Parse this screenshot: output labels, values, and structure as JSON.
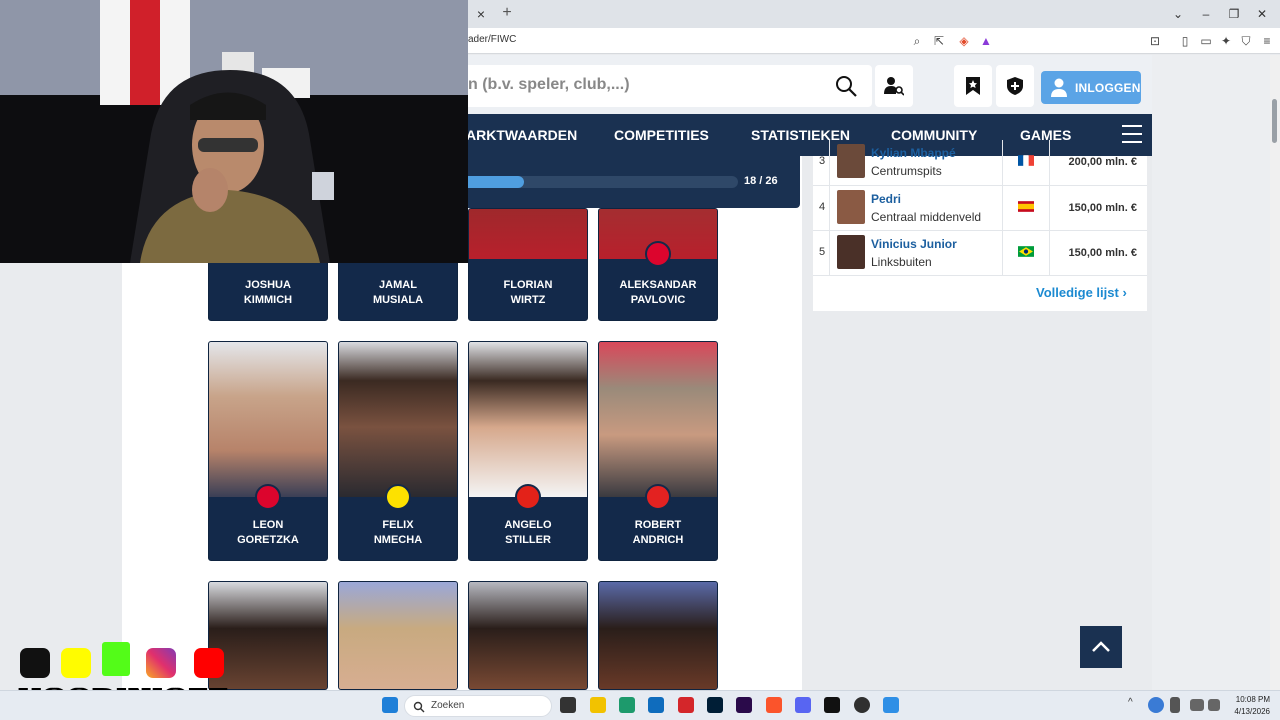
{
  "browser": {
    "url": "ader/FIWC",
    "tab_close": "×",
    "tab_new": "+"
  },
  "header": {
    "search_placeholder": "n (b.v. speler, club,...)",
    "login_label": "INLOGGEN"
  },
  "nav": {
    "items": [
      "ARKTWAARDEN",
      "COMPETITIES",
      "STATISTIEKEN",
      "COMMUNITY",
      "GAMES"
    ]
  },
  "progress": {
    "text": "18 / 26",
    "current": 18,
    "total": 26
  },
  "players_row1": [
    {
      "first": "JOSHUA",
      "last": "KIMMICH"
    },
    {
      "first": "JAMAL",
      "last": "MUSIALA"
    },
    {
      "first": "FLORIAN",
      "last": "WIRTZ"
    },
    {
      "first": "ALEKSANDAR",
      "last": "PAVLOVIC"
    }
  ],
  "players_row2": [
    {
      "first": "LEON",
      "last": "GORETZKA"
    },
    {
      "first": "FELIX",
      "last": "NMECHA"
    },
    {
      "first": "ANGELO",
      "last": "STILLER"
    },
    {
      "first": "ROBERT",
      "last": "ANDRICH"
    }
  ],
  "ranking": {
    "rows": [
      {
        "rank": "3",
        "name": "Kylian Mbappé",
        "position": "Centrumspits",
        "value": "200,00 mln. €",
        "flag": "fr"
      },
      {
        "rank": "4",
        "name": "Pedri",
        "position": "Centraal middenveld",
        "value": "150,00 mln. €",
        "flag": "es"
      },
      {
        "rank": "5",
        "name": "Vinicius Junior",
        "position": "Linksbuiten",
        "value": "150,00 mln. €",
        "flag": "br"
      }
    ],
    "full_list": "Volledige lijst"
  },
  "overlay": {
    "streamer": "HOODINIOFF"
  },
  "taskbar": {
    "search": "Zoeken",
    "time": "10:08 PM",
    "date": "4/13/2026"
  },
  "colors": {
    "navy": "#1a3151",
    "accent_blue": "#5ba4e6",
    "link_blue": "#1c5f9f"
  }
}
